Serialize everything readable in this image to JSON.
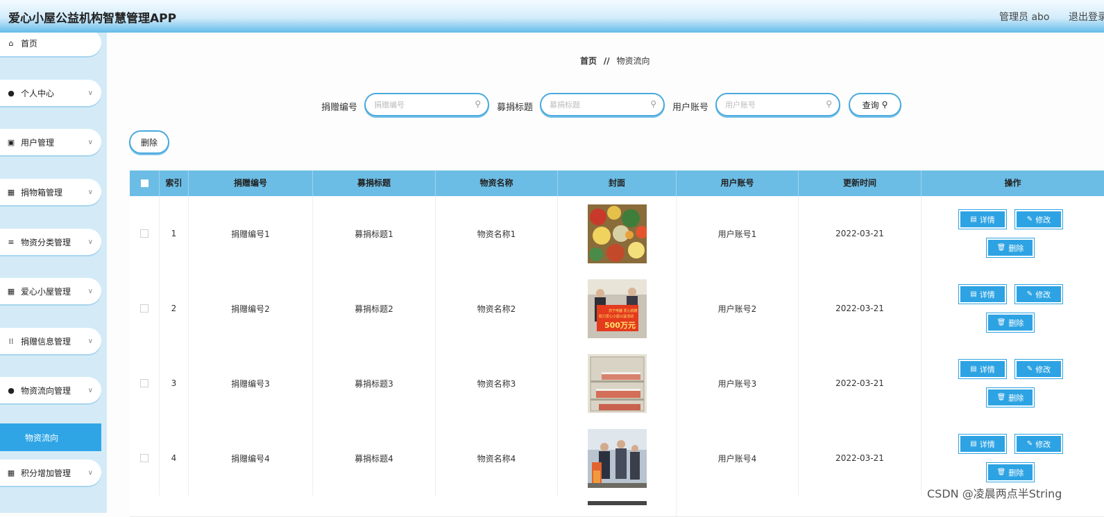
{
  "header": {
    "app_title": "爱心小屋公益机构智慧管理APP",
    "user": "管理员 abo",
    "logout": "退出登录"
  },
  "sidebar": {
    "items": [
      {
        "label": "首页",
        "icon": "home-icon",
        "glyph": "⌂",
        "expandable": false
      },
      {
        "label": "个人中心",
        "icon": "user-icon",
        "glyph": "●",
        "expandable": true
      },
      {
        "label": "用户管理",
        "icon": "chart-icon",
        "glyph": "▣",
        "expandable": true
      },
      {
        "label": "捐物箱管理",
        "icon": "grid-icon",
        "glyph": "▦",
        "expandable": true
      },
      {
        "label": "物资分类管理",
        "icon": "list-icon",
        "glyph": "≡",
        "expandable": true
      },
      {
        "label": "爱心小屋管理",
        "icon": "grid-icon",
        "glyph": "▦",
        "expandable": true
      },
      {
        "label": "捐赠信息管理",
        "icon": "apps-icon",
        "glyph": "⁞⁞",
        "expandable": true
      },
      {
        "label": "物资流向管理",
        "icon": "location-pin-icon",
        "glyph": "●",
        "expandable": true
      },
      {
        "label": "积分增加管理",
        "icon": "grid-icon",
        "glyph": "▦",
        "expandable": true
      }
    ],
    "active_sub_item": "物资流向"
  },
  "breadcrumb": {
    "home": "首页",
    "separator": "//",
    "current": "物资流向"
  },
  "search": {
    "fields": [
      {
        "label": "捐赠编号",
        "placeholder": "捐赠编号"
      },
      {
        "label": "募捐标题",
        "placeholder": "募捐标题"
      },
      {
        "label": "用户账号",
        "placeholder": "用户账号"
      }
    ],
    "query_button": "查询"
  },
  "toolbar": {
    "delete_button": "删除"
  },
  "table": {
    "columns": [
      "索引",
      "捐赠编号",
      "募捐标题",
      "物资名称",
      "封面",
      "用户账号",
      "更新时间",
      "操作"
    ],
    "rows": [
      {
        "index": "1",
        "donation_no": "捐赠编号1",
        "title": "募捐标题1",
        "material": "物资名称1",
        "account": "用户账号1",
        "updated": "2022-03-21"
      },
      {
        "index": "2",
        "donation_no": "捐赠编号2",
        "title": "募捐标题2",
        "material": "物资名称2",
        "account": "用户账号2",
        "updated": "2022-03-21"
      },
      {
        "index": "3",
        "donation_no": "捐赠编号3",
        "title": "募捐标题3",
        "material": "物资名称3",
        "account": "用户账号3",
        "updated": "2022-03-21"
      },
      {
        "index": "4",
        "donation_no": "捐赠编号4",
        "title": "募捐标题4",
        "material": "物资名称4",
        "account": "用户账号4",
        "updated": "2022-03-21"
      }
    ],
    "actions": {
      "detail": "详情",
      "edit": "修改",
      "delete": "删除"
    }
  },
  "cover_images": {
    "banner_text": "500万元",
    "banner_line1": "苏宁电器 爱心捐赠",
    "banner_line2": "助力爱心小屋公益活动"
  },
  "watermark": "CSDN @凌晨两点半String",
  "colors": {
    "primary": "#2da3e3",
    "table_header": "#6cbde5",
    "sidebar_bg": "#d4ebf7",
    "header_accent": "#63bbe9"
  }
}
